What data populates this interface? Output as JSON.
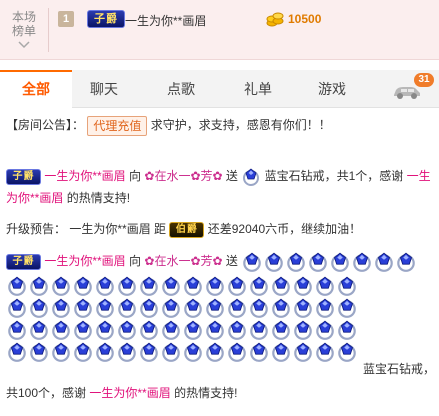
{
  "rank": {
    "label_line1": "本场",
    "label_line2": "榜单",
    "position": "1",
    "user_name": "一生为你**画眉",
    "coins": "10500"
  },
  "tabs": [
    {
      "label": "全部",
      "active": true
    },
    {
      "label": "聊天",
      "active": false
    },
    {
      "label": "点歌",
      "active": false
    },
    {
      "label": "礼单",
      "active": false
    },
    {
      "label": "游戏",
      "active": false
    }
  ],
  "car_badge_count": "31",
  "badges": {
    "zi_jue": "子爵",
    "bo_jue": "伯爵"
  },
  "messages": {
    "announcement": {
      "prefix": "【房间公告】：",
      "button": "代理充值",
      "text": "求守护，求支持，感恩有你们！！"
    },
    "gift1": {
      "sender": "一生为你**画眉",
      "to_word": "向",
      "receiver": "✿在水一✿芳✿",
      "send_word": "送",
      "gift_text": "蓝宝石钻戒，共1个，感谢",
      "thank_name": "一生为你**画眉",
      "thank_suffix": "的热情支持!"
    },
    "upgrade": {
      "prefix": "升级预告：",
      "name": "一生为你**画眉",
      "distance_word": "距",
      "suffix": "还差92040六币，继续加油！"
    },
    "gift2": {
      "sender": "一生为你**画眉",
      "to_word": "向",
      "receiver": "✿在水一✿芳✿",
      "send_word": "送",
      "gift_text": "蓝宝石钻戒，",
      "line2_prefix": "共100个，感谢",
      "thank_name": "一生为你**画眉",
      "thank_suffix": "的热情支持!"
    }
  },
  "colors": {
    "accent": "#ff5a00",
    "name": "#e0107a",
    "coin": "#e07b00"
  }
}
